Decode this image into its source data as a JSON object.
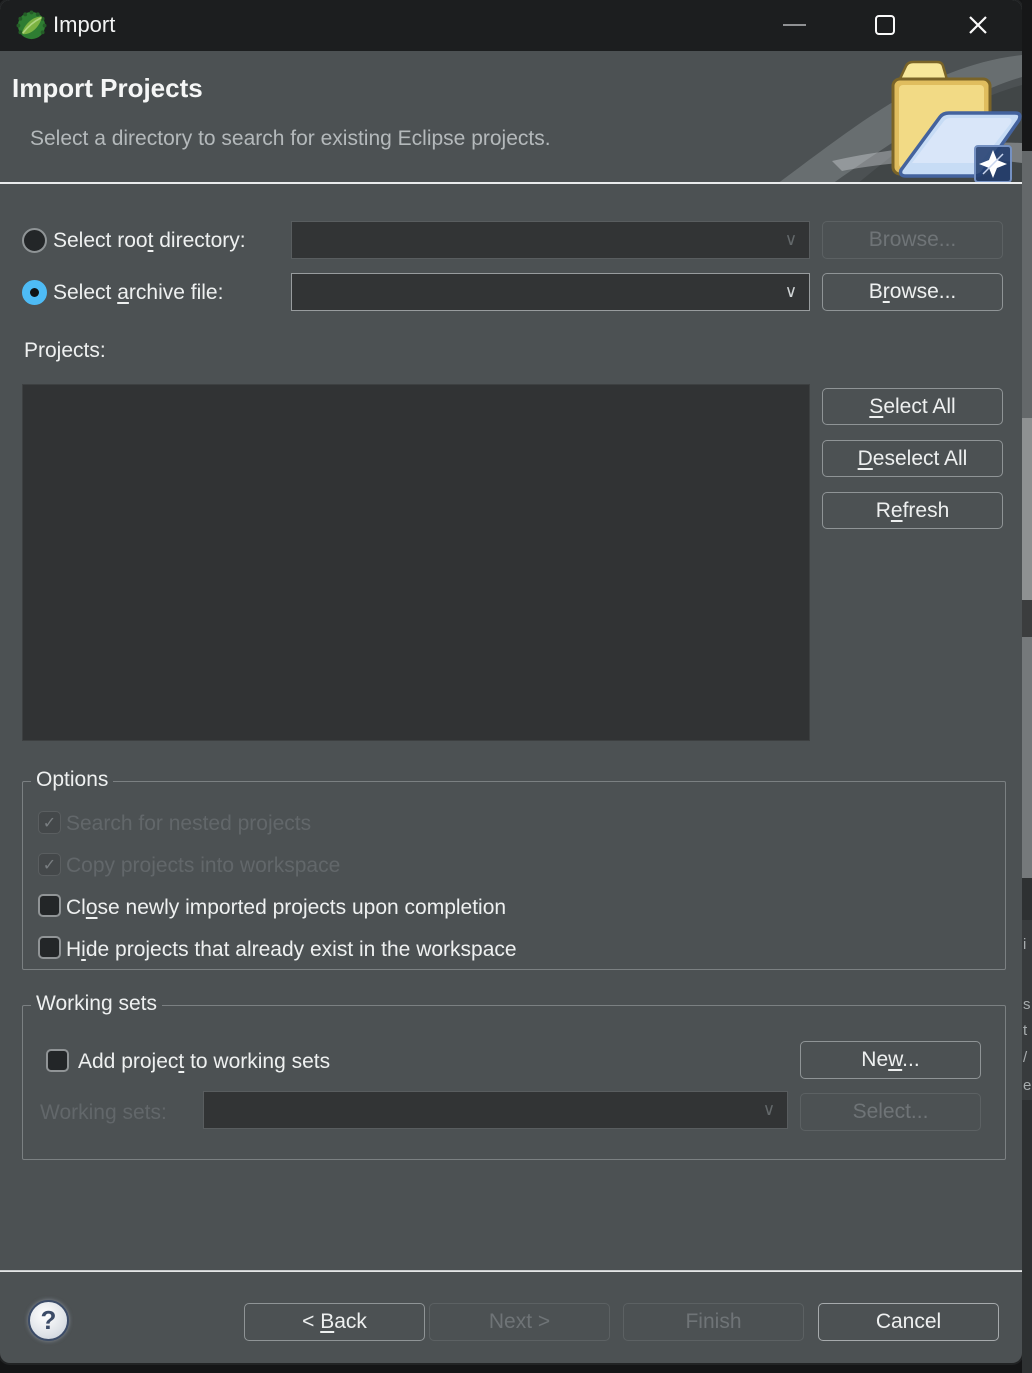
{
  "window": {
    "title": "Import"
  },
  "header": {
    "title": "Import Projects",
    "subtitle": "Select a directory to search for existing Eclipse projects."
  },
  "source": {
    "root_label": {
      "pre": "Select roo",
      "mn": "t",
      "post": " directory:"
    },
    "root_value": "",
    "root_browse": "Browse...",
    "archive_label": {
      "pre": "Select ",
      "mn": "a",
      "post": "rchive file:"
    },
    "archive_value": "",
    "archive_browse": {
      "pre": "B",
      "mn": "r",
      "post": "owse..."
    }
  },
  "projects": {
    "label": "Projects:",
    "select_all": {
      "mn": "S",
      "post": "elect All"
    },
    "deselect_all": {
      "mn": "D",
      "post": "eselect All"
    },
    "refresh": {
      "pre": "R",
      "mn": "e",
      "post": "fresh"
    }
  },
  "options": {
    "legend": "Options",
    "items": [
      {
        "label": "Search for nested projects",
        "checked": true,
        "enabled": false
      },
      {
        "label": "Copy projects into workspace",
        "checked": true,
        "enabled": false
      },
      {
        "pre": "Cl",
        "mn": "o",
        "post": "se newly imported projects upon completion",
        "checked": false,
        "enabled": true
      },
      {
        "pre": "H",
        "mn": "i",
        "post": "de projects that already exist in the workspace",
        "checked": false,
        "enabled": true
      }
    ]
  },
  "working_sets": {
    "legend": "Working sets",
    "add_label": {
      "pre": "Add projec",
      "mn": "t",
      "post": " to working sets"
    },
    "new_button": {
      "pre": "Ne",
      "mn": "w",
      "post": "..."
    },
    "sets_label": "Working sets:",
    "sets_value": "",
    "select_button": "Select..."
  },
  "footer": {
    "help": "?",
    "back": {
      "pre": "< ",
      "mn": "B",
      "post": "ack"
    },
    "next": "Next >",
    "finish": "Finish",
    "cancel": "Cancel"
  },
  "icons": {
    "check": "✓",
    "chevron_down": "∨"
  },
  "colors": {
    "dialog_bg": "#4c5153",
    "titlebar_bg": "#1c1e1f",
    "list_bg": "#313334",
    "accent_blue": "#4ebbf5",
    "disabled_text": "#62676a"
  },
  "edge_artifacts": {
    "letters": [
      "i",
      "s",
      "t",
      "/",
      "e"
    ]
  }
}
